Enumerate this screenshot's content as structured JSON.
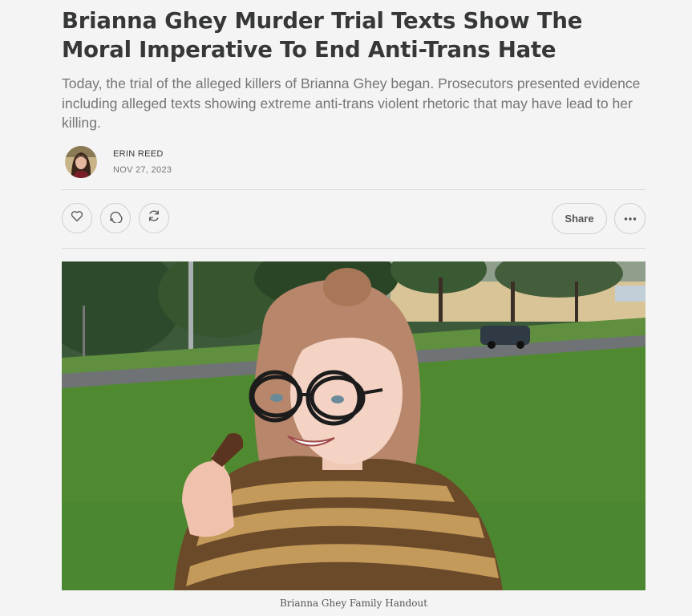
{
  "post": {
    "title": "Brianna Ghey Murder Trial Texts Show The Moral Imperative To End Anti-Trans Hate",
    "subtitle": "Today, the trial of the alleged killers of Brianna Ghey began. Prosecutors presented evidence including alleged texts showing extreme anti-trans violent rhetoric that may have lead to her killing.",
    "author": "ERIN REED",
    "date": "NOV 27, 2023"
  },
  "actions": {
    "like_icon": "heart-icon",
    "comment_icon": "comment-icon",
    "restack_icon": "restack-icon",
    "share_label": "Share",
    "more_icon": "ellipsis-icon"
  },
  "hero": {
    "caption": "Brianna Ghey Family Handout"
  },
  "colors": {
    "background": "#f4f4f4",
    "text": "#363737",
    "muted": "#757575",
    "border": "#cfcfcf"
  }
}
